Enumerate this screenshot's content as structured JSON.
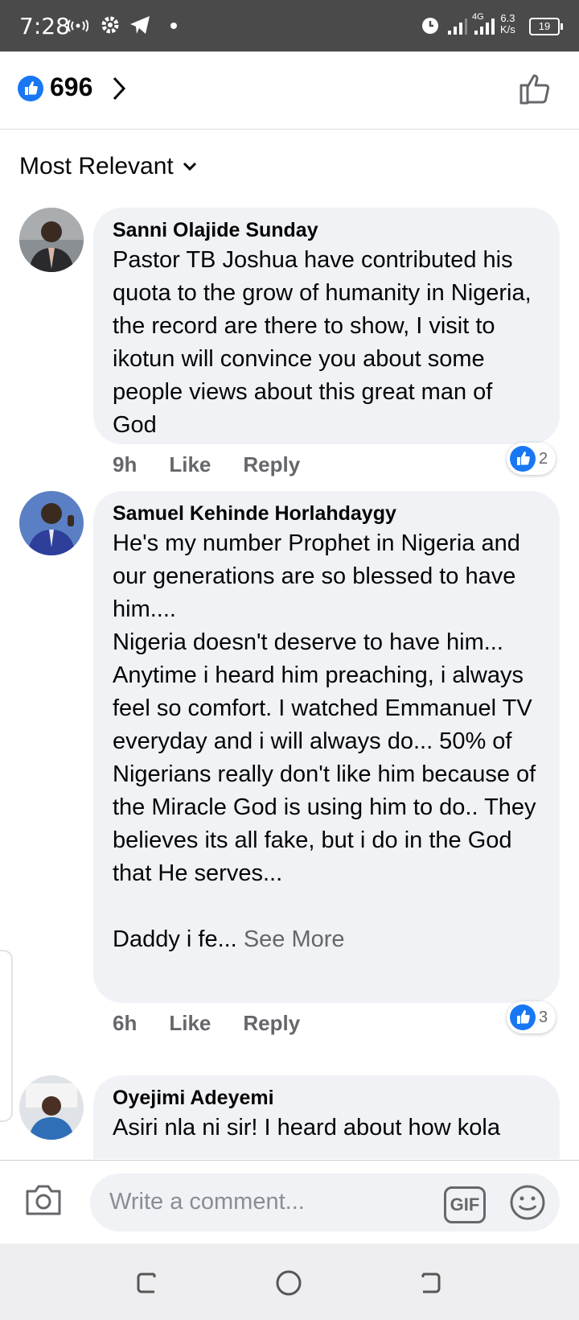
{
  "status_bar": {
    "time": "7:28",
    "network": "4G",
    "speed": "6.3",
    "speed_unit": "K/s",
    "battery": "19"
  },
  "header": {
    "reaction_count": "696"
  },
  "sort": {
    "label": "Most Relevant"
  },
  "comments": [
    {
      "author": "Sanni Olajide Sunday",
      "text": "Pastor TB Joshua have contributed his quota to the grow of humanity in Nigeria, the record are there to show, I visit to ikotun will convince you about some people views about this great man of God",
      "time": "9h",
      "like": "Like",
      "reply": "Reply",
      "reactions": "2"
    },
    {
      "author": "Samuel Kehinde Horlahdaygy",
      "text": "He's my number Prophet in Nigeria and our generations are so blessed to have him....\nNigeria doesn't deserve to have him... Anytime i heard him preaching, i always feel so comfort. I watched Emmanuel TV everyday and i will always do... 50% of Nigerians really don't like him because of the Miracle God is using him to do.. They believes its all fake, but i do in the God that He serves...\n\nDaddy i fe... ",
      "see_more": "See More",
      "time": "6h",
      "like": "Like",
      "reply": "Reply",
      "reactions": "3"
    },
    {
      "author": "Oyejimi Adeyemi",
      "text": "Asiri nla ni sir! I heard about how kola"
    }
  ],
  "composer": {
    "placeholder": "Write a comment...",
    "gif_label": "GIF"
  },
  "colors": {
    "accent": "#1877f2",
    "bubble": "#f0f2f5",
    "meta": "#65676b"
  }
}
